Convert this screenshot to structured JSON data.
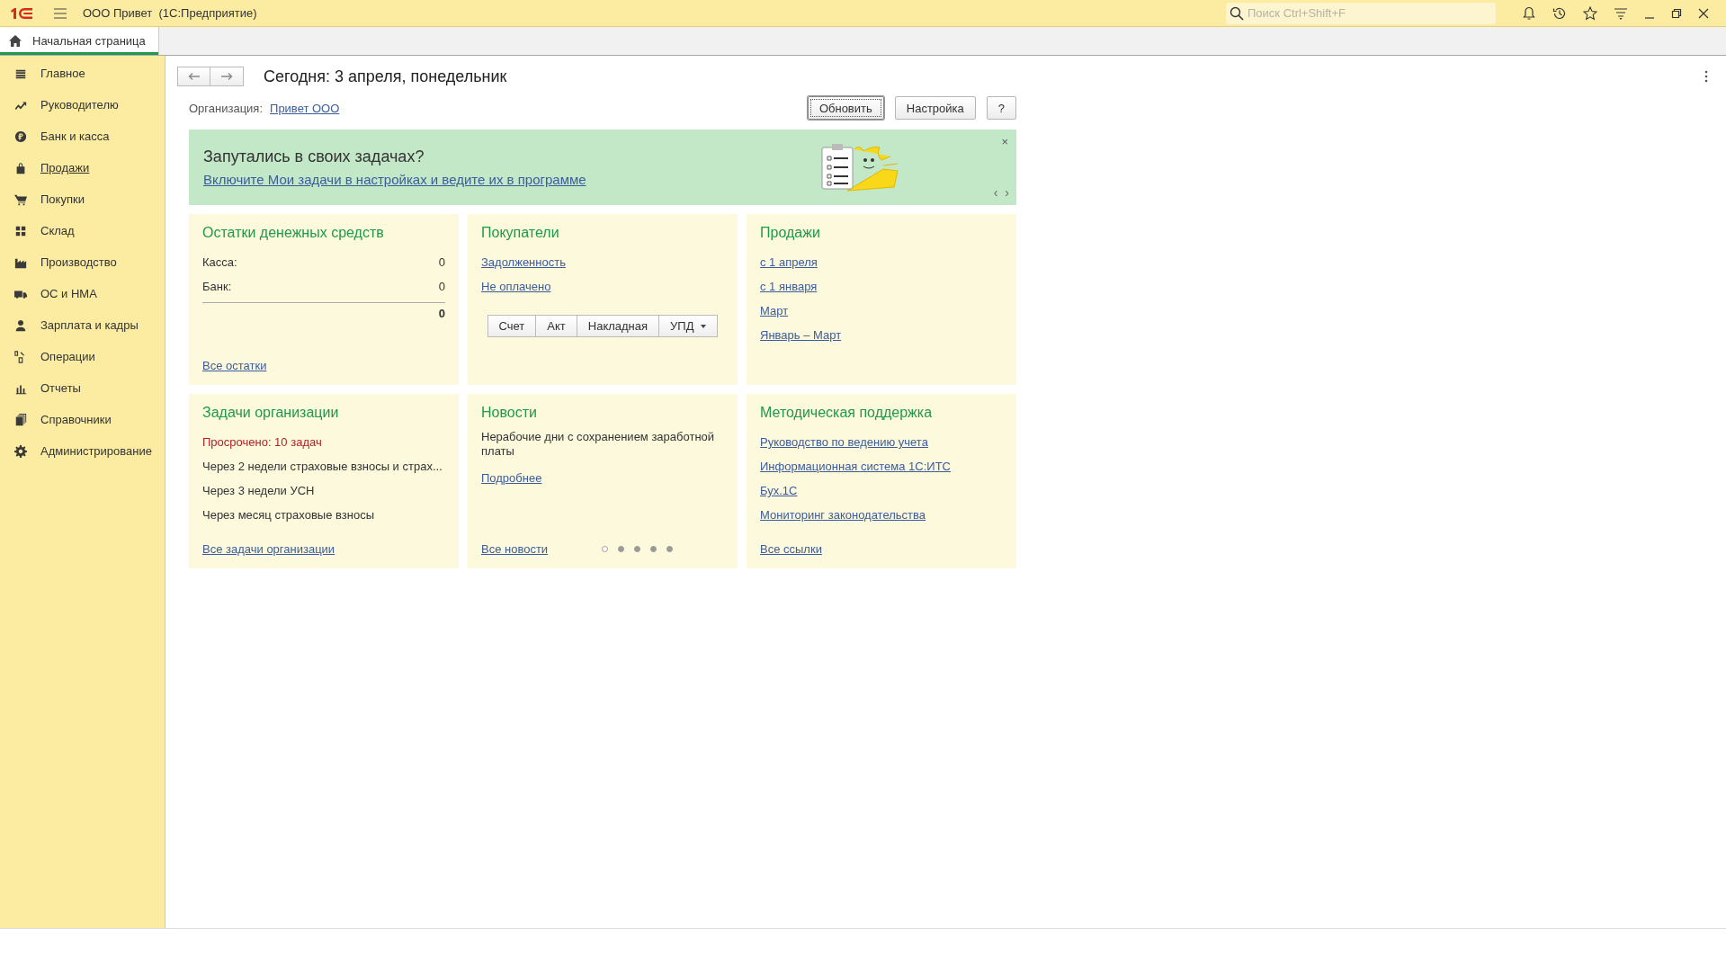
{
  "window": {
    "title": "ООО Привет  (1С:Предприятие)",
    "search": {
      "placeholder": "Поиск Ctrl+Shift+F"
    }
  },
  "tabs": [
    {
      "label": "Начальная страница",
      "selected": true
    }
  ],
  "sidebar": {
    "items": [
      {
        "label": "Главное",
        "hovered": false
      },
      {
        "label": "Руководителю",
        "hovered": false
      },
      {
        "label": "Банк и касса",
        "hovered": false
      },
      {
        "label": "Продажи",
        "hovered": true
      },
      {
        "label": "Покупки",
        "hovered": false
      },
      {
        "label": "Склад",
        "hovered": false
      },
      {
        "label": "Производство",
        "hovered": false
      },
      {
        "label": "ОС и НМА",
        "hovered": false
      },
      {
        "label": "Зарплата и кадры",
        "hovered": false
      },
      {
        "label": "Операции",
        "hovered": false
      },
      {
        "label": "Отчеты",
        "hovered": false
      },
      {
        "label": "Справочники",
        "hovered": false
      },
      {
        "label": "Администрирование",
        "hovered": false
      }
    ]
  },
  "page": {
    "title": "Сегодня: 3 апреля, понедельник",
    "organization_label": "Организация:",
    "organization": "Привет ООО",
    "buttons": [
      {
        "label": "Обновить",
        "default": true
      },
      {
        "label": "Настройка",
        "default": false
      },
      {
        "label": "?",
        "default": false
      }
    ]
  },
  "banner": {
    "title": "Запутались в своих задачах?",
    "link": "Включите Мои задачи в настройках и ведите их в программе",
    "close": "×",
    "prev": "‹",
    "next": "›"
  },
  "cash": {
    "title": "Остатки денежных средств",
    "rows": [
      {
        "label": "Касса:",
        "value": "0"
      },
      {
        "label": "Банк:",
        "value": "0"
      }
    ],
    "total": "0",
    "link": "Все остатки"
  },
  "customers": {
    "title": "Покупатели",
    "links": [
      "Задолженность",
      "Не оплачено"
    ],
    "documents": [
      {
        "label": "Счет",
        "kind": "plain"
      },
      {
        "label": "Акт",
        "kind": "plain"
      },
      {
        "label": "Накладная",
        "kind": "plain"
      },
      {
        "label": "УПД",
        "kind": "dropdown"
      }
    ]
  },
  "sales": {
    "title": "Продажи",
    "links": [
      "с 1 апреля",
      "с 1 января",
      "Март",
      "Январь – Март"
    ]
  },
  "tasks": {
    "title": "Задачи организации",
    "overdue": "Просрочено: 10 задач",
    "items": [
      "Через 2 недели страховые взносы и страх...",
      "Через 3 недели УСН",
      "Через месяц страховые взносы"
    ],
    "link": "Все задачи организации"
  },
  "news": {
    "title": "Новости",
    "text": "Нерабочие дни с сохранением заработной платы",
    "more": "Подробнее",
    "link": "Все новости",
    "pages": [
      {
        "selected": true
      },
      {
        "selected": false
      },
      {
        "selected": false
      },
      {
        "selected": false
      },
      {
        "selected": false
      }
    ]
  },
  "support": {
    "title": "Методическая поддержка",
    "links": [
      "Руководство по ведению учета",
      "Информационная система 1С:ИТС",
      "Бух.1С",
      "Мониторинг законодательства"
    ],
    "link": "Все ссылки"
  }
}
